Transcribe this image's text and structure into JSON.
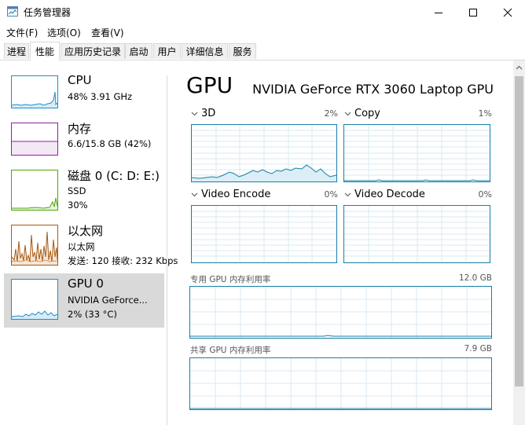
{
  "window": {
    "title": "任务管理器",
    "controls": [
      "minimize-icon",
      "maximize-icon",
      "close-icon"
    ]
  },
  "menu": [
    "文件(F)",
    "选项(O)",
    "查看(V)"
  ],
  "tabs": [
    "进程",
    "性能",
    "应用历史记录",
    "启动",
    "用户",
    "详细信息",
    "服务"
  ],
  "active_tab": "性能",
  "sidebar": [
    {
      "title": "CPU",
      "line1": "48% 3.91 GHz",
      "line2": "",
      "color": "#1f8fc7"
    },
    {
      "title": "内存",
      "line1": "6.6/15.8 GB (42%)",
      "line2": "",
      "color": "#8e1f9c"
    },
    {
      "title": "磁盘 0 (C: D: E:)",
      "line1": "SSD",
      "line2": "30%",
      "color": "#4da60c"
    },
    {
      "title": "以太网",
      "line1": "以太网",
      "line2": "发送: 120  接收: 232 Kbps",
      "color": "#a85a12"
    },
    {
      "title": "GPU 0",
      "line1": "NVIDIA GeForce...",
      "line2": "2% (33 °C)",
      "color": "#1f8fc7"
    }
  ],
  "main": {
    "heading": "GPU",
    "model": "NVIDIA GeForce RTX 3060 Laptop GPU",
    "engines": [
      {
        "label": "3D",
        "percent": "2%"
      },
      {
        "label": "Copy",
        "percent": "1%"
      },
      {
        "label": "Video Encode",
        "percent": "0%"
      },
      {
        "label": "Video Decode",
        "percent": "0%"
      }
    ],
    "dedicated_label": "专用 GPU 内存利用率",
    "dedicated_total": "12.0 GB",
    "shared_label": "共享 GPU 内存利用率",
    "shared_total": "7.9 GB"
  },
  "colors": {
    "gpu_line": "#167fa8",
    "grid": "#d9eaf3"
  }
}
